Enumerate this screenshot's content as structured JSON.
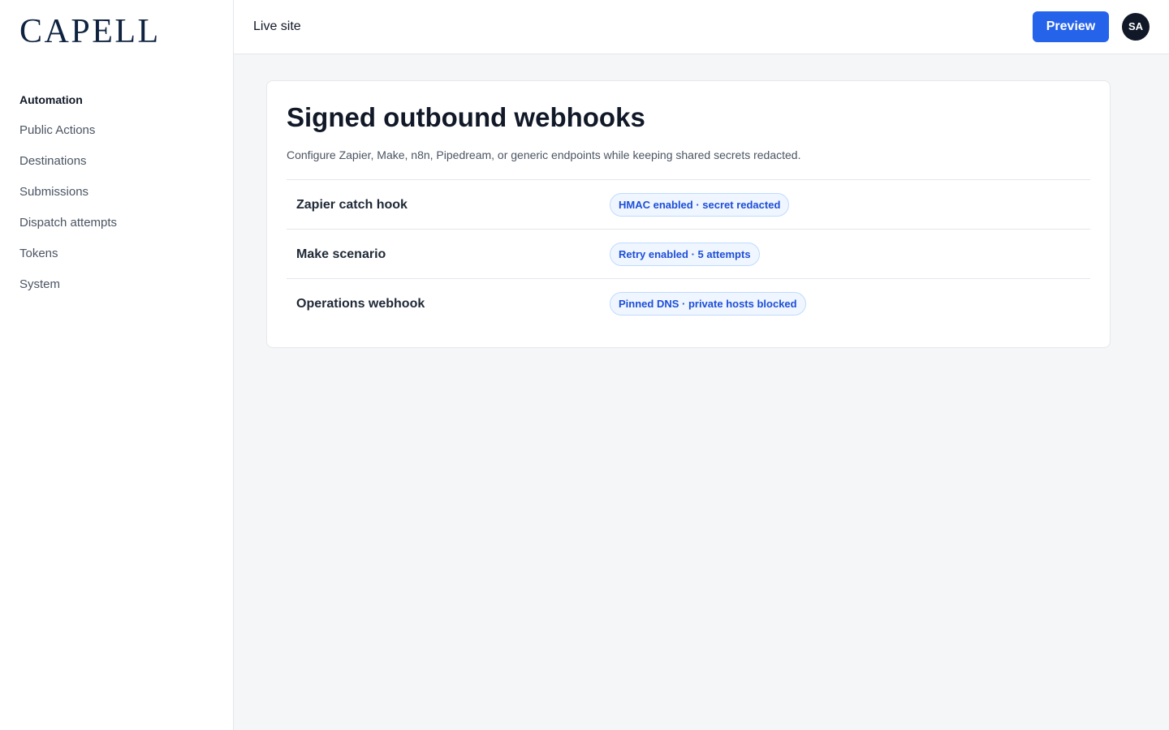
{
  "brand": {
    "name": "CAPELL"
  },
  "sidebar": {
    "section_label": "Automation",
    "items": [
      {
        "label": "Public Actions"
      },
      {
        "label": "Destinations"
      },
      {
        "label": "Submissions"
      },
      {
        "label": "Dispatch attempts"
      },
      {
        "label": "Tokens"
      },
      {
        "label": "System"
      }
    ]
  },
  "topbar": {
    "live_site_label": "Live site",
    "preview_label": "Preview",
    "avatar_initials": "SA"
  },
  "card": {
    "title": "Signed outbound webhooks",
    "description": "Configure Zapier, Make, n8n, Pipedream, or generic endpoints while keeping shared secrets redacted.",
    "rows": [
      {
        "name": "Zapier catch hook",
        "badge": "HMAC enabled · secret redacted"
      },
      {
        "name": "Make scenario",
        "badge": "Retry enabled · 5 attempts"
      },
      {
        "name": "Operations webhook",
        "badge": "Pinned DNS · private hosts blocked"
      }
    ]
  },
  "colors": {
    "accent": "#2563eb",
    "brand": "#0f2340",
    "badge_text": "#1d4ed8",
    "badge_bg": "#eff6ff"
  }
}
